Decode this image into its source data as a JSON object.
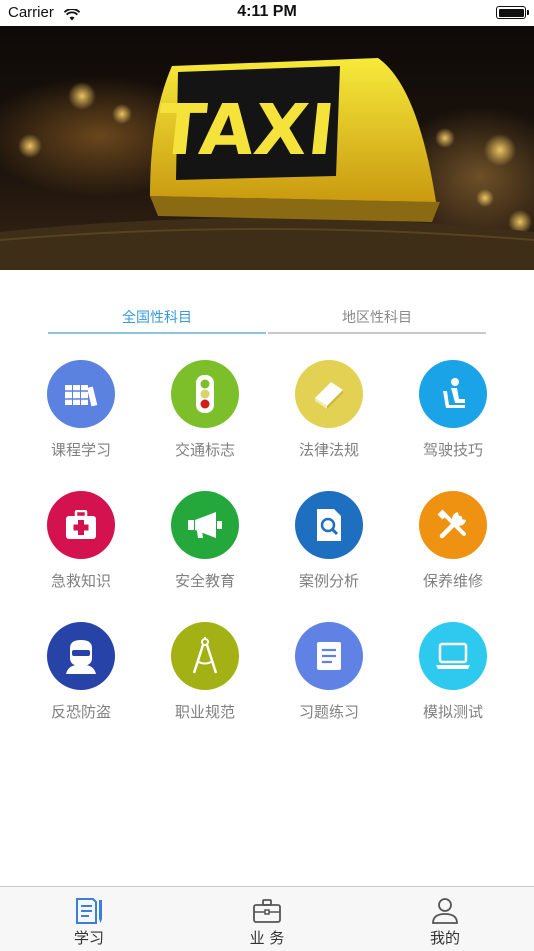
{
  "status_bar": {
    "carrier": "Carrier",
    "time": "4:11 PM"
  },
  "banner": {
    "sign_text": "TAXI"
  },
  "tabs": [
    {
      "label": "全国性科目",
      "active": true
    },
    {
      "label": "地区性科目",
      "active": false
    }
  ],
  "grid": [
    {
      "label": "课程学习",
      "icon": "books-icon",
      "color": "#5b82e0"
    },
    {
      "label": "交通标志",
      "icon": "traffic-light-icon",
      "color": "#7cbf2a"
    },
    {
      "label": "法律法规",
      "icon": "law-book-icon",
      "color": "#e3d154"
    },
    {
      "label": "驾驶技巧",
      "icon": "driver-seat-icon",
      "color": "#1ba3e8"
    },
    {
      "label": "急救知识",
      "icon": "first-aid-icon",
      "color": "#d4124f"
    },
    {
      "label": "安全教育",
      "icon": "megaphone-icon",
      "color": "#24a83c"
    },
    {
      "label": "案例分析",
      "icon": "document-search-icon",
      "color": "#1e6fbf"
    },
    {
      "label": "保养维修",
      "icon": "tools-icon",
      "color": "#ef9211"
    },
    {
      "label": "反恐防盗",
      "icon": "masked-thief-icon",
      "color": "#2743a8"
    },
    {
      "label": "职业规范",
      "icon": "compass-icon",
      "color": "#a3b114"
    },
    {
      "label": "习题练习",
      "icon": "notes-icon",
      "color": "#5f82e4"
    },
    {
      "label": "模拟测试",
      "icon": "laptop-icon",
      "color": "#2ec9ee"
    }
  ],
  "tab_bar": [
    {
      "label": "学习",
      "icon": "study-icon",
      "active": true
    },
    {
      "label": "业 务",
      "icon": "briefcase-icon",
      "active": false
    },
    {
      "label": "我的",
      "icon": "profile-icon",
      "active": false
    }
  ],
  "colors": {
    "accent": "#3a9ad9",
    "tab_active_line": "#8fc3e3",
    "tab_inactive_line": "#c9c9c9",
    "label_gray": "#808080"
  }
}
